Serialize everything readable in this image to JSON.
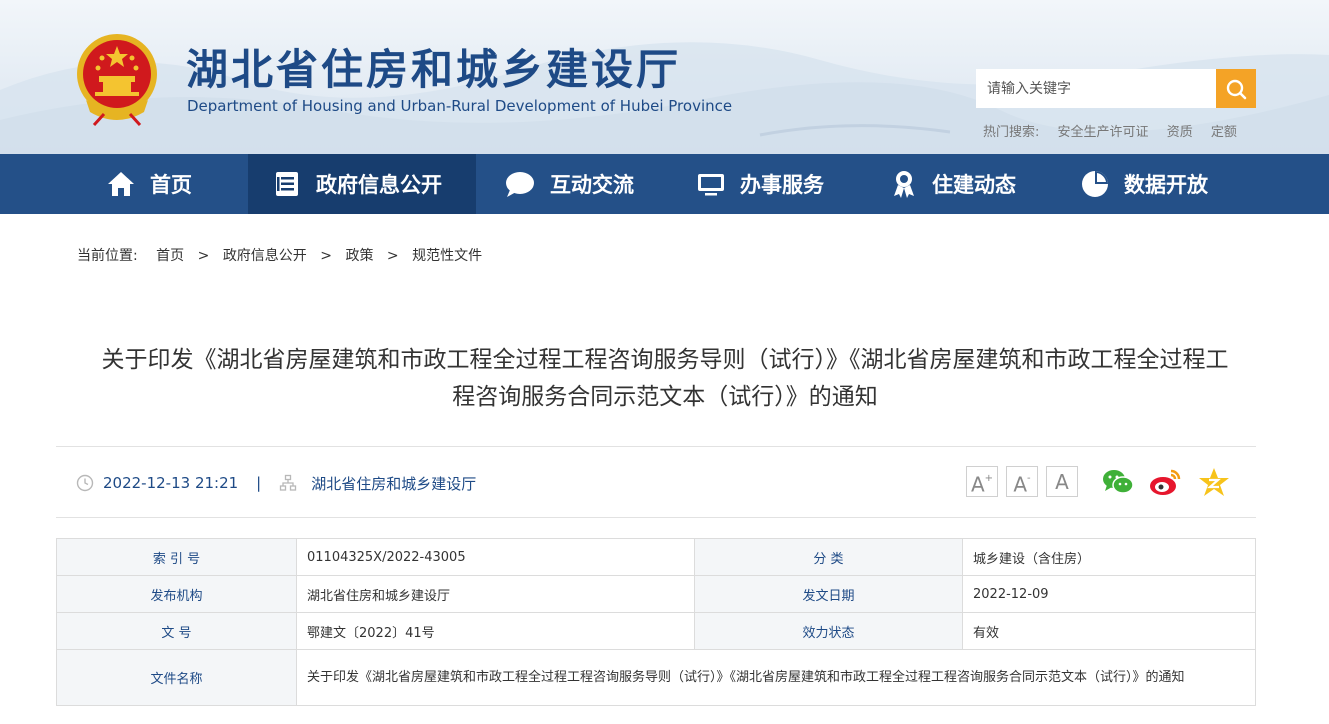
{
  "header": {
    "title": "湖北省住房和城乡建设厅",
    "subtitle": "Department of Housing and Urban-Rural Development of Hubei Province",
    "search_placeholder": "请输入关键字",
    "hot_label": "热门搜索:",
    "hot_keywords": [
      "安全生产许可证",
      "资质",
      "定额"
    ]
  },
  "nav": {
    "items": [
      {
        "label": "首页",
        "icon": "home-icon"
      },
      {
        "label": "政府信息公开",
        "icon": "document-list-icon"
      },
      {
        "label": "互动交流",
        "icon": "chat-bubble-icon"
      },
      {
        "label": "办事服务",
        "icon": "monitor-icon"
      },
      {
        "label": "住建动态",
        "icon": "award-ribbon-icon"
      },
      {
        "label": "数据开放",
        "icon": "pie-chart-icon"
      }
    ],
    "active_index": 1
  },
  "breadcrumb": {
    "label": "当前位置:",
    "items": [
      "首页",
      "政府信息公开",
      "政策",
      "规范性文件"
    ],
    "separator": ">"
  },
  "article": {
    "title_line1": "关于印发《湖北省房屋建筑和市政工程全过程工程咨询服务导则（试行）》《湖北省房屋建筑和市政工程全过程工",
    "title_line2": "程咨询服务合同示范文本（试行）》的通知",
    "datetime": "2022-12-13 21:21",
    "divider": "|",
    "source": "湖北省住房和城乡建设厅",
    "font_buttons": [
      "A",
      "A",
      "A"
    ]
  },
  "info_table": {
    "index_label": "索 引 号",
    "index_value": "01104325X/2022-43005",
    "category_label": "分 类",
    "category_value": "城乡建设（含住房）",
    "publisher_label": "发布机构",
    "publisher_value": "湖北省住房和城乡建设厅",
    "issue_date_label": "发文日期",
    "issue_date_value": "2022-12-09",
    "doc_no_label": "文 号",
    "doc_no_value": "鄂建文〔2022〕41号",
    "status_label": "效力状态",
    "status_value": "有效",
    "doc_name_label": "文件名称",
    "doc_name_value": "关于印发《湖北省房屋建筑和市政工程全过程工程咨询服务导则（试行）》《湖北省房屋建筑和市政工程全过程工程咨询服务合同示范文本（试行）》的通知"
  },
  "colors": {
    "brand_blue": "#245088",
    "nav_active": "#173d6e",
    "search_orange": "#f4a326",
    "text_blue": "#1e4a86"
  }
}
